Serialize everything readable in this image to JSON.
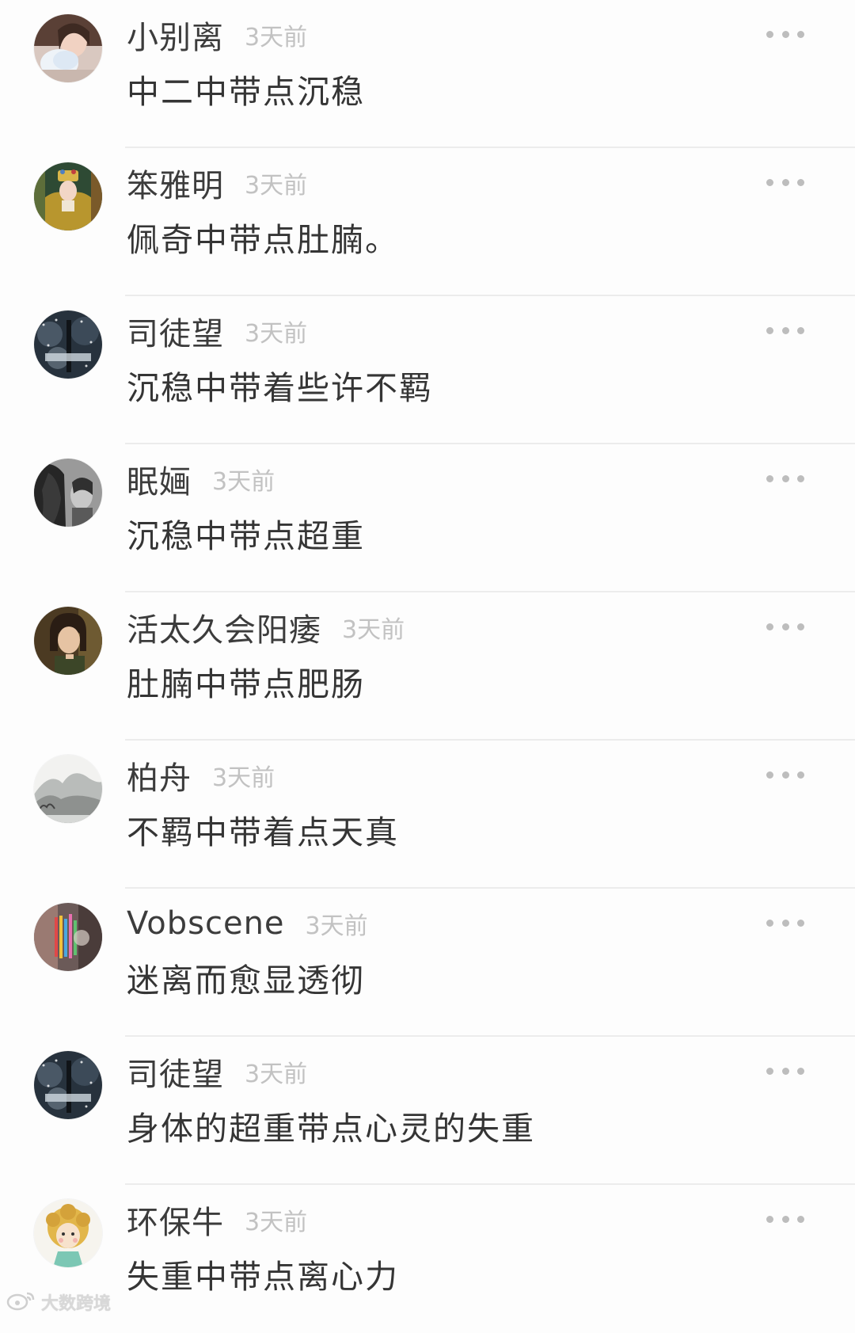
{
  "comments": [
    {
      "username": "小别离",
      "time": "3天前",
      "content": "中二中带点沉稳",
      "avatar": "girl-photo-avatar"
    },
    {
      "username": "笨雅明",
      "time": "3天前",
      "content": "佩奇中带点肚腩。",
      "avatar": "opera-performer-avatar"
    },
    {
      "username": "司徒望",
      "time": "3天前",
      "content": "沉稳中带着些许不羁",
      "avatar": "snow-tree-avatar"
    },
    {
      "username": "眠婳",
      "time": "3天前",
      "content": "沉稳中带点超重",
      "avatar": "horse-portrait-avatar"
    },
    {
      "username": "活太久会阳痿",
      "time": "3天前",
      "content": "肚腩中带点肥肠",
      "avatar": "film-girl-avatar"
    },
    {
      "username": "柏舟",
      "time": "3天前",
      "content": "不羁中带着点天真",
      "avatar": "ink-landscape-avatar"
    },
    {
      "username": "Vobscene",
      "time": "3天前",
      "content": "迷离而愈显透彻",
      "avatar": "colorful-lights-avatar"
    },
    {
      "username": "司徒望",
      "time": "3天前",
      "content": "身体的超重带点心灵的失重",
      "avatar": "snow-tree-avatar"
    },
    {
      "username": "环保牛",
      "time": "3天前",
      "content": "失重中带点离心力",
      "avatar": "cartoon-child-avatar"
    }
  ],
  "more_icon": "more-dots-icon",
  "watermark": {
    "text": "大数跨境",
    "icon": "weibo-logo-icon"
  }
}
